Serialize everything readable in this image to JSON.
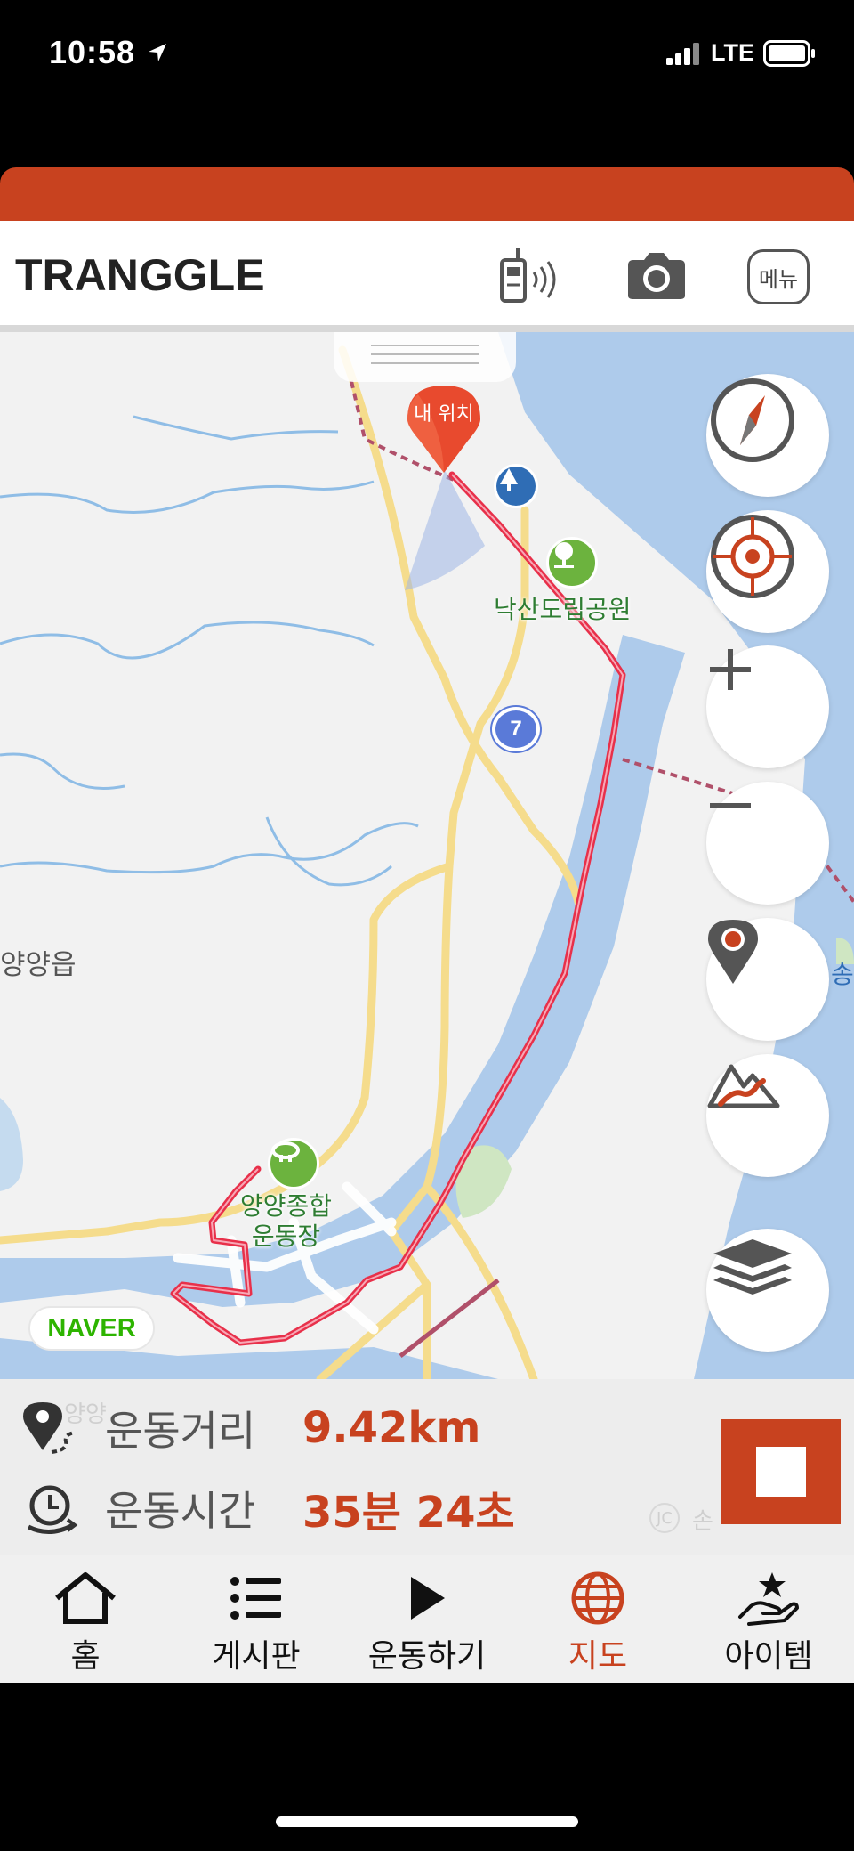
{
  "status_bar": {
    "time": "10:58",
    "network": "LTE"
  },
  "header": {
    "brand": "TRANGGLE",
    "menu_label": "메뉴"
  },
  "map": {
    "labels": {
      "park": "낙산도립공원",
      "town": "양양읍",
      "stadium_line1": "양양종합",
      "stadium_line2": "운동장",
      "east_edge": "송",
      "faded_left": "양양",
      "faded_jc": "JC",
      "faded_right": "손"
    },
    "my_location": "내 위치",
    "road_number": "7",
    "attribution": "NAVER",
    "colors": {
      "route": "#e8304a",
      "water": "#aecbeb",
      "road": "#f5dc8c"
    }
  },
  "stats": {
    "distance_label": "운동거리",
    "distance_value": "9.42km",
    "time_label": "운동시간",
    "time_value": "35분 24초"
  },
  "tabs": [
    {
      "label": "홈",
      "icon": "home-icon"
    },
    {
      "label": "게시판",
      "icon": "list-icon"
    },
    {
      "label": "운동하기",
      "icon": "play-icon"
    },
    {
      "label": "지도",
      "icon": "globe-icon",
      "active": true
    },
    {
      "label": "아이템",
      "icon": "hand-star-icon"
    }
  ],
  "accent_color": "#c8421f"
}
